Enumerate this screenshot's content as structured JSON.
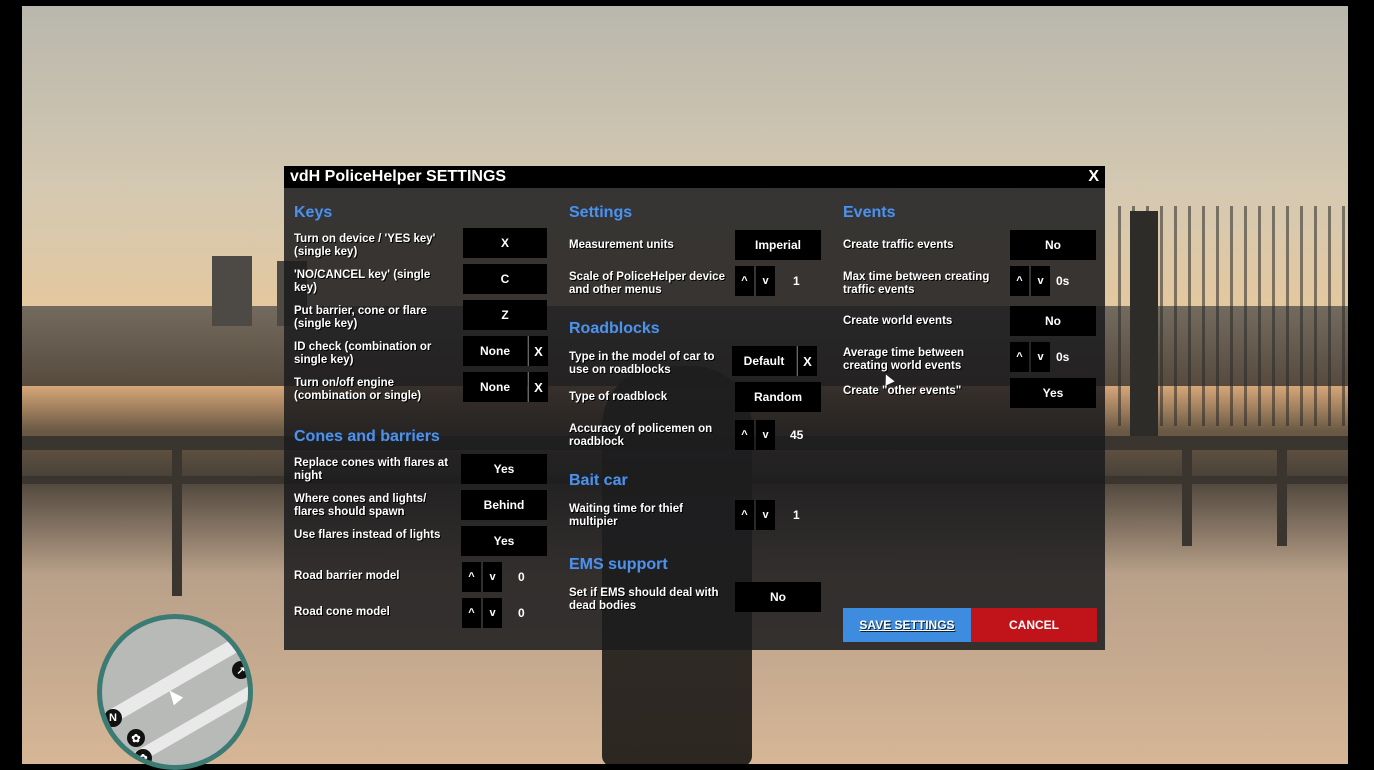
{
  "window": {
    "title": "vdH PoliceHelper SETTINGS",
    "close_label": "X"
  },
  "keys": {
    "heading": "Keys",
    "rows": [
      {
        "label": "Turn on device / 'YES key' (single key)",
        "value": "X"
      },
      {
        "label": "'NO/CANCEL key' (single key)",
        "value": "C"
      },
      {
        "label": "Put barrier, cone or flare (single key)",
        "value": "Z"
      },
      {
        "label": "ID check (combination or single key)",
        "value": "None",
        "clear": "X"
      },
      {
        "label": "Turn on/off engine (combination or single)",
        "value": "None",
        "clear": "X"
      }
    ]
  },
  "cones": {
    "heading": "Cones and barriers",
    "rows": [
      {
        "label": "Replace cones with flares at night",
        "value": "Yes"
      },
      {
        "label": "Where cones and lights/ flares should spawn",
        "value": "Behind"
      },
      {
        "label": "Use flares instead of lights",
        "value": "Yes"
      },
      {
        "label": "Road barrier model",
        "up": "^",
        "down": "v",
        "value": "0"
      },
      {
        "label": "Road cone model",
        "up": "^",
        "down": "v",
        "value": "0"
      }
    ]
  },
  "settings": {
    "heading": "Settings",
    "rows": [
      {
        "label": "Measurement units",
        "value": "Imperial"
      },
      {
        "label": "Scale of PoliceHelper device and other menus",
        "up": "^",
        "down": "v",
        "value": "1"
      }
    ]
  },
  "roadblocks": {
    "heading": "Roadblocks",
    "rows": [
      {
        "label": "Type in the model of car to use on roadblocks",
        "value": "Default",
        "clear": "X"
      },
      {
        "label": "Type of roadblock",
        "value": "Random"
      },
      {
        "label": "Accuracy of policemen on roadblock",
        "up": "^",
        "down": "v",
        "value": "45"
      }
    ]
  },
  "bait": {
    "heading": "Bait car",
    "rows": [
      {
        "label": "Waiting time for thief multipier",
        "up": "^",
        "down": "v",
        "value": "1"
      }
    ]
  },
  "ems": {
    "heading": "EMS support",
    "rows": [
      {
        "label": "Set if EMS should deal with dead bodies",
        "value": "No"
      }
    ]
  },
  "events": {
    "heading": "Events",
    "rows": [
      {
        "label": "Create traffic events",
        "value": "No"
      },
      {
        "label": "Max time between creating traffic events",
        "up": "^",
        "down": "v",
        "value": "0s"
      },
      {
        "label": "Create world events",
        "value": "No"
      },
      {
        "label": "Average time between creating world events",
        "up": "^",
        "down": "v",
        "value": "0s"
      },
      {
        "label": "Create \"other events\"",
        "value": "Yes"
      }
    ]
  },
  "actions": {
    "save": "SAVE SETTINGS",
    "cancel": "CANCEL"
  },
  "minimap": {
    "north": "N"
  },
  "colors": {
    "heading": "#4f91e2",
    "save": "#3d8ce0",
    "cancel": "#c1141a"
  }
}
